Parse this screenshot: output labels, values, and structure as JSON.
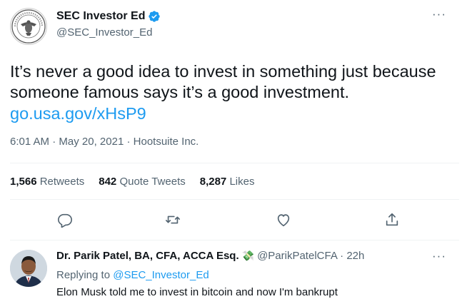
{
  "tweet": {
    "display_name": "SEC Investor Ed",
    "handle": "@SEC_Investor_Ed",
    "more_label": "···",
    "text": "It’s never a good idea to invest in something just because someone famous says it’s a good investment.",
    "link": "go.usa.gov/xHsP9",
    "time": "6:01 AM",
    "date": "May 20, 2021",
    "source": "Hootsuite Inc.",
    "meta_separator": "·",
    "stats": {
      "retweets_count": "1,566",
      "retweets_label": "Retweets",
      "quotes_count": "842",
      "quotes_label": "Quote Tweets",
      "likes_count": "8,287",
      "likes_label": "Likes"
    },
    "actions": [
      "reply-icon",
      "retweet-icon",
      "like-icon",
      "share-icon"
    ]
  },
  "reply": {
    "display_name": "Dr. Parik Patel, BA, CFA, ACCA Esq.",
    "emoji": "💸",
    "handle_time": "@ParikPatelCFA · 22h",
    "more_label": "···",
    "replying_prefix": "Replying to",
    "replying_to": "@SEC_Investor_Ed",
    "text": "Elon Musk told me to invest in bitcoin and now I'm bankrupt"
  },
  "colors": {
    "accent": "#1d9bf0",
    "secondary_text": "#536471",
    "primary_text": "#0f1419",
    "divider": "#eff3f4"
  }
}
